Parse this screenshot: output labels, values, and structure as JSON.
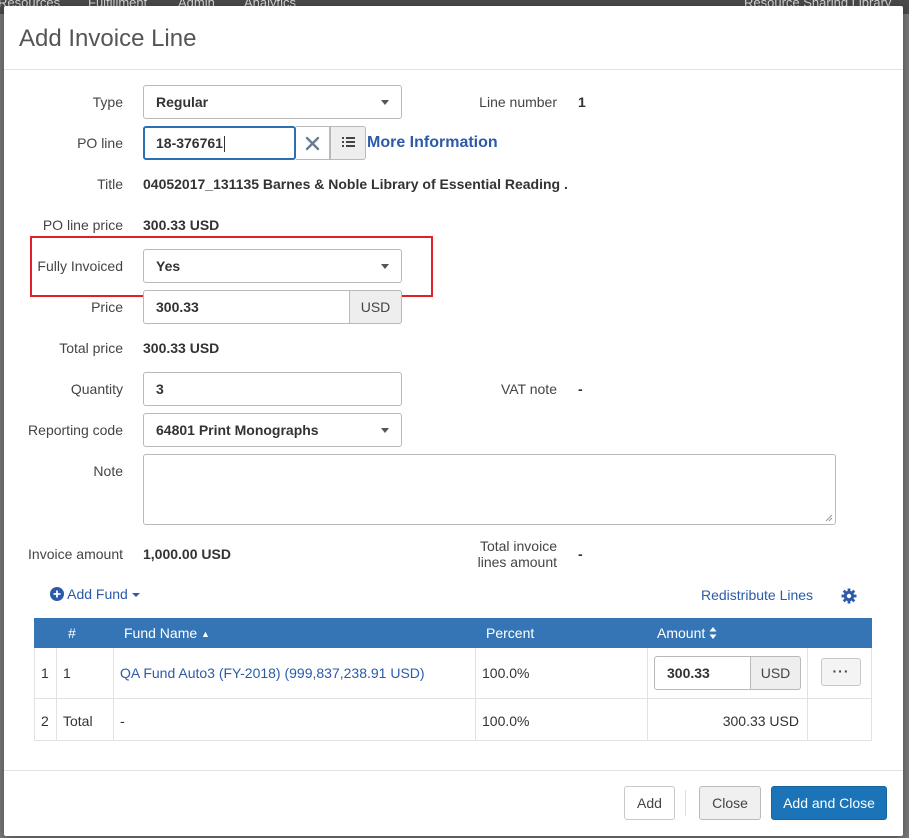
{
  "background": {
    "nav_items": [
      "Resources",
      "Fulfillment",
      "Admin",
      "Analytics",
      "Resource Sharing Library"
    ]
  },
  "dialog": {
    "title": "Add Invoice Line"
  },
  "form": {
    "type": {
      "label": "Type",
      "value": "Regular"
    },
    "line_number": {
      "label": "Line number",
      "value": "1"
    },
    "po_line": {
      "label": "PO line",
      "value": "18-376761",
      "more_info": "More Information"
    },
    "title": {
      "label": "Title",
      "value": "04052017_131135 Barnes & Noble Library of Essential Reading ."
    },
    "po_line_price": {
      "label": "PO line price",
      "value": "300.33 USD"
    },
    "fully_invoiced": {
      "label": "Fully Invoiced",
      "value": "Yes"
    },
    "price": {
      "label": "Price",
      "value": "300.33",
      "currency": "USD"
    },
    "total_price": {
      "label": "Total price",
      "value": "300.33 USD"
    },
    "quantity": {
      "label": "Quantity",
      "value": "3"
    },
    "vat_note": {
      "label": "VAT note",
      "value": "-"
    },
    "reporting_code": {
      "label": "Reporting code",
      "value": "64801 Print Monographs"
    },
    "note": {
      "label": "Note",
      "value": ""
    },
    "invoice_amount": {
      "label": "Invoice amount",
      "value": "1,000.00 USD"
    },
    "total_invoice_lines_amount": {
      "label_line1": "Total invoice",
      "label_line2": "lines amount",
      "value": "-"
    }
  },
  "funds": {
    "add_fund_label": "Add Fund",
    "redistribute_label": "Redistribute Lines",
    "columns": {
      "num": "#",
      "fund_name": "Fund Name",
      "percent": "Percent",
      "amount": "Amount"
    },
    "rows": [
      {
        "index": "1",
        "num": "1",
        "fund_name": "QA Fund Auto3 (FY-2018) (999,837,238.91 USD)",
        "percent": "100.0%",
        "amount": "300.33",
        "currency": "USD",
        "actions": "···"
      },
      {
        "index": "2",
        "num": "Total",
        "fund_name": "-",
        "percent": "100.0%",
        "amount": "300.33 USD"
      }
    ]
  },
  "footer": {
    "add": "Add",
    "close": "Close",
    "add_and_close": "Add and Close"
  },
  "colors": {
    "primary": "#1b74b8",
    "table_header": "#3575b5",
    "link": "#2b5ba8",
    "highlight": "#e0202a"
  }
}
